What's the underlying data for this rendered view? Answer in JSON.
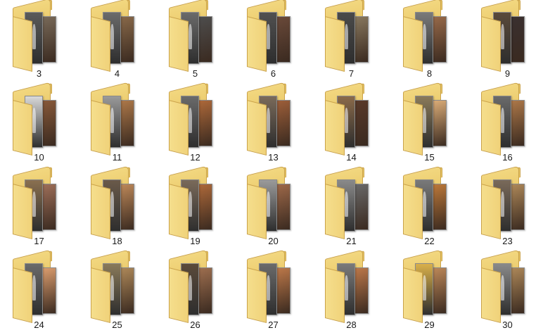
{
  "folders": [
    {
      "name": "3",
      "colors": [
        "#5a5a5a",
        "#7a6b5a"
      ]
    },
    {
      "name": "4",
      "colors": [
        "#6b6b6b",
        "#8a6a4a"
      ]
    },
    {
      "name": "5",
      "colors": [
        "#6a6a6a",
        "#4e4e4e"
      ]
    },
    {
      "name": "6",
      "colors": [
        "#505050",
        "#6b4a3a"
      ]
    },
    {
      "name": "7",
      "colors": [
        "#4a4a4a",
        "#8a7a60"
      ]
    },
    {
      "name": "8",
      "colors": [
        "#7a7a7a",
        "#9a6b4a"
      ]
    },
    {
      "name": "9",
      "colors": [
        "#5a4a3a",
        "#3a3030"
      ]
    },
    {
      "name": "10",
      "colors": [
        "#d9d9d9",
        "#8a5a3a"
      ]
    },
    {
      "name": "11",
      "colors": [
        "#9a9a9a",
        "#b07a4a"
      ]
    },
    {
      "name": "12",
      "colors": [
        "#6a6a6a",
        "#b06a3a"
      ]
    },
    {
      "name": "13",
      "colors": [
        "#7a6a5a",
        "#a0603a"
      ]
    },
    {
      "name": "14",
      "colors": [
        "#8a6a4a",
        "#5a3a2a"
      ]
    },
    {
      "name": "15",
      "colors": [
        "#8a7a5a",
        "#e0b07a"
      ]
    },
    {
      "name": "16",
      "colors": [
        "#6a6a6a",
        "#b07a4a"
      ]
    },
    {
      "name": "17",
      "colors": [
        "#8a7050",
        "#a0705a"
      ]
    },
    {
      "name": "18",
      "colors": [
        "#6a5a4a",
        "#c08a5a"
      ]
    },
    {
      "name": "19",
      "colors": [
        "#7a6a5a",
        "#b06a3a"
      ]
    },
    {
      "name": "20",
      "colors": [
        "#9a9a9a",
        "#a06a4a"
      ]
    },
    {
      "name": "21",
      "colors": [
        "#8a8a8a",
        "#6a6a6a"
      ]
    },
    {
      "name": "22",
      "colors": [
        "#7a7a7a",
        "#c07a3a"
      ]
    },
    {
      "name": "23",
      "colors": [
        "#7a6a5a",
        "#b08a5a"
      ]
    },
    {
      "name": "24",
      "colors": [
        "#6a6a6a",
        "#e0a070"
      ]
    },
    {
      "name": "25",
      "colors": [
        "#8a7a5a",
        "#b08a5a"
      ]
    },
    {
      "name": "26",
      "colors": [
        "#5a4a3a",
        "#a07050"
      ]
    },
    {
      "name": "27",
      "colors": [
        "#6a6a6a",
        "#c07a4a"
      ]
    },
    {
      "name": "28",
      "colors": [
        "#7a7a7a",
        "#c07a4a"
      ]
    },
    {
      "name": "29",
      "colors": [
        "#d9b04a",
        "#c08a5a"
      ]
    },
    {
      "name": "30",
      "colors": [
        "#8a8a8a",
        "#b08a5a"
      ]
    }
  ],
  "folder_icon": "folder-with-photos-icon"
}
